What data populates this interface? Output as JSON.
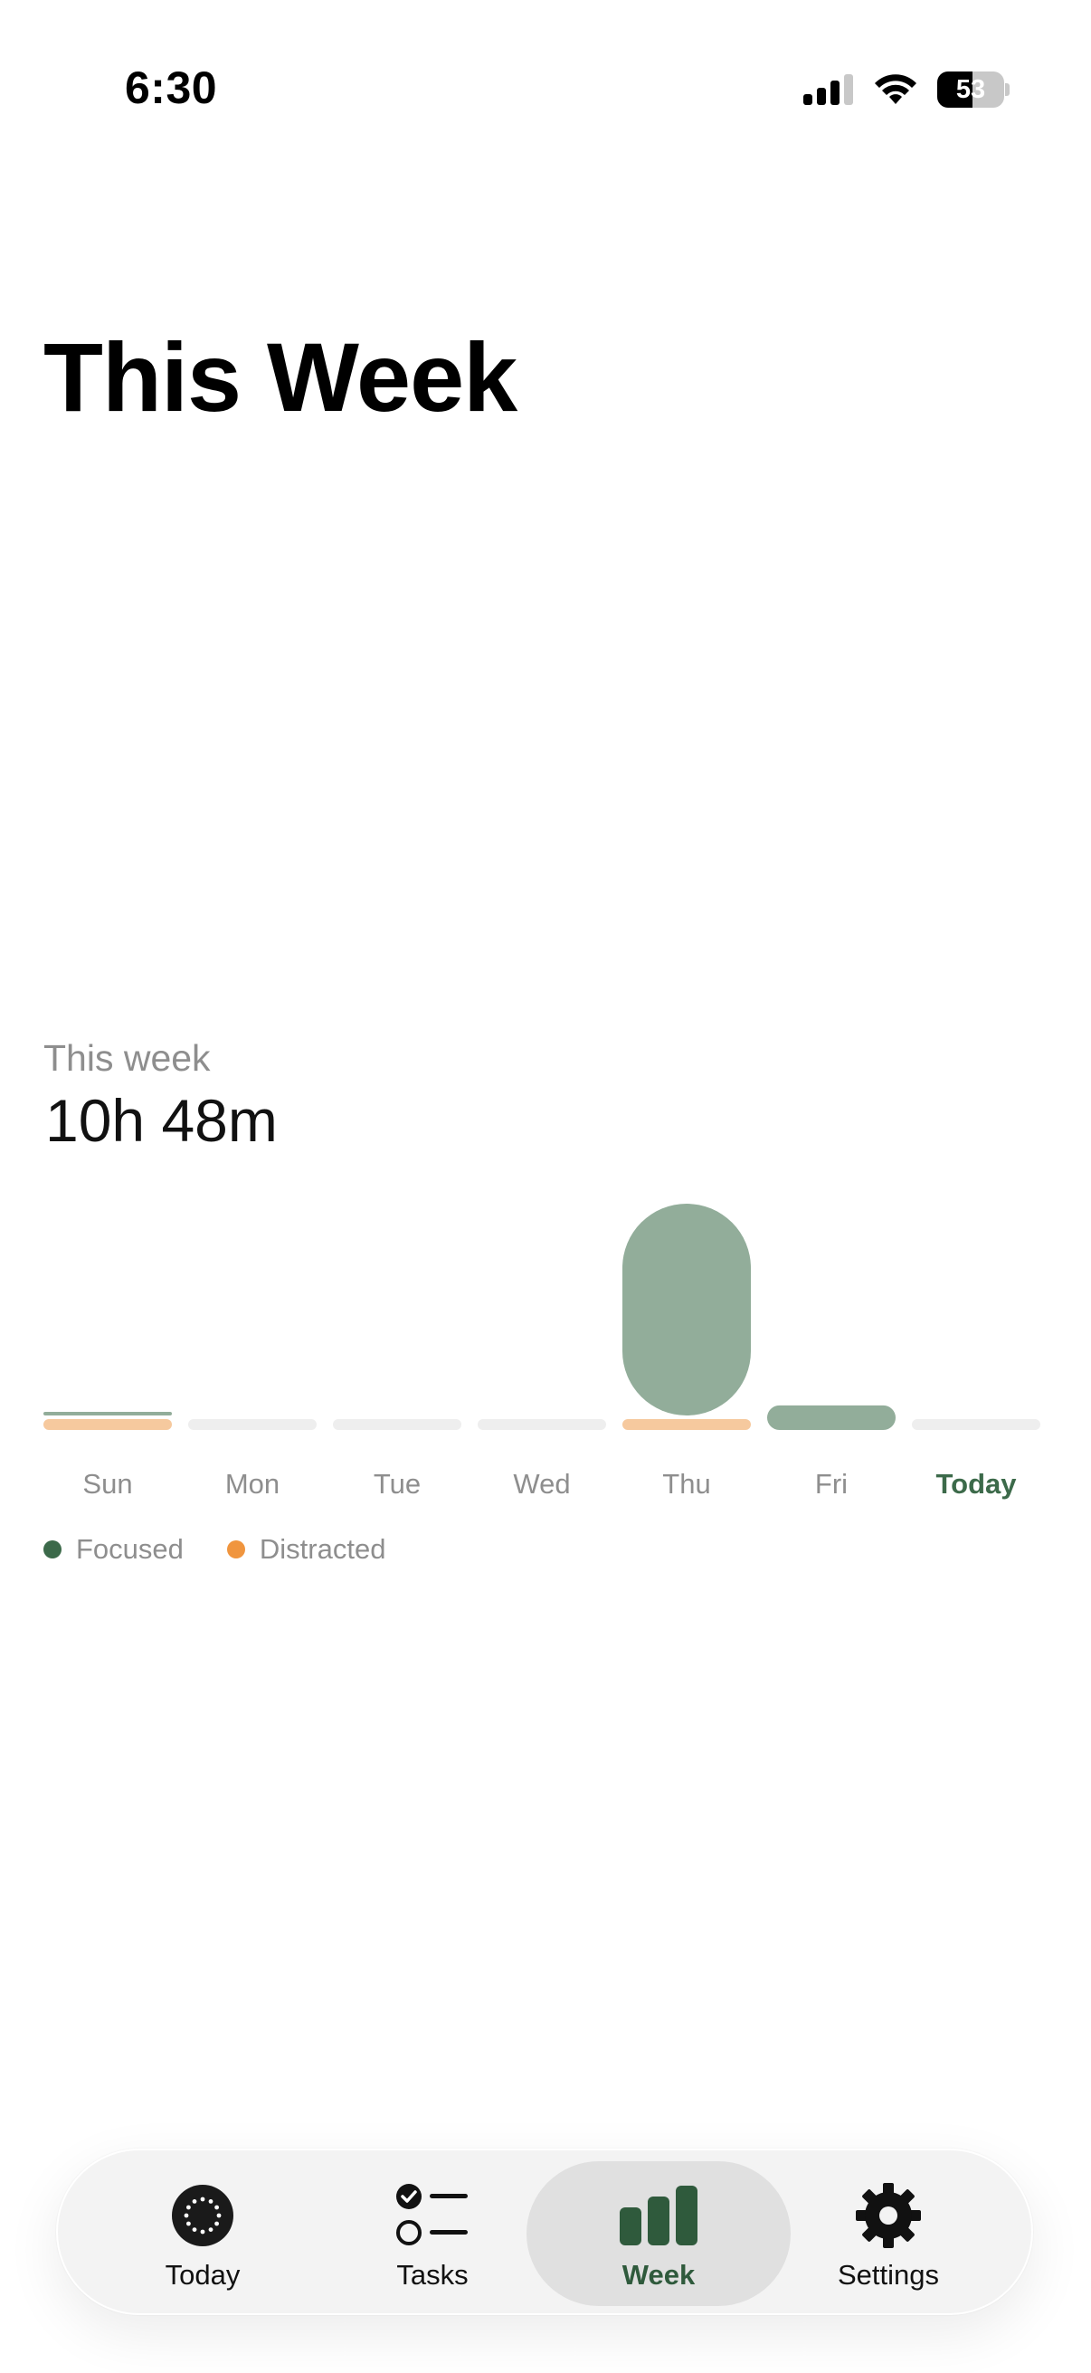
{
  "status_bar": {
    "time": "6:30",
    "battery_level": "53",
    "battery_fraction": 0.53
  },
  "page": {
    "title": "This Week"
  },
  "summary": {
    "label": "This week",
    "total": "10h 48m"
  },
  "colors": {
    "focused": "#3c6a4a",
    "focused_bar": "#92ad9a",
    "distracted": "#f0953e",
    "distracted_bar": "#f6c99e",
    "empty_bar": "#eeeeee",
    "today_label": "#3c6a4a"
  },
  "chart_data": {
    "type": "bar",
    "categories": [
      "Sun",
      "Mon",
      "Tue",
      "Wed",
      "Thu",
      "Fri",
      "Today"
    ],
    "series": [
      {
        "name": "Focused",
        "values": [
          0.05,
          0,
          0,
          0,
          9.5,
          1.1,
          0
        ]
      },
      {
        "name": "Distracted",
        "values": [
          0.15,
          0,
          0,
          0,
          0.1,
          0,
          0
        ]
      }
    ],
    "unit": "h",
    "highlighted_category": "Today",
    "legend": [
      "Focused",
      "Distracted"
    ],
    "legend_position": "bottom-left",
    "grid": false
  },
  "tab_bar": {
    "active": "week",
    "tabs": [
      {
        "id": "today",
        "label": "Today",
        "icon": "dotted-circle-icon"
      },
      {
        "id": "tasks",
        "label": "Tasks",
        "icon": "checklist-icon"
      },
      {
        "id": "week",
        "label": "Week",
        "icon": "bar-chart-icon"
      },
      {
        "id": "settings",
        "label": "Settings",
        "icon": "gear-icon"
      }
    ]
  }
}
